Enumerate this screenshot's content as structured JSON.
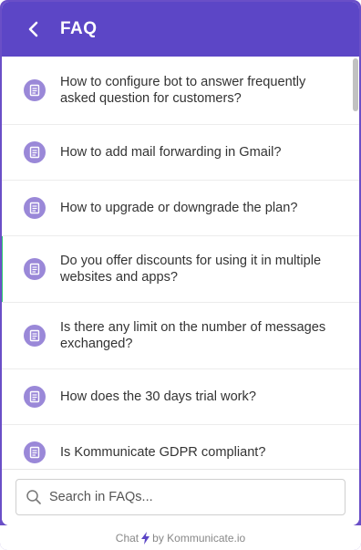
{
  "header": {
    "title": "FAQ",
    "accent_color": "#5c46c6"
  },
  "faqs": [
    {
      "question": "How to configure bot to answer frequently asked question for customers?",
      "icon": "document-icon"
    },
    {
      "question": "How to add mail forwarding in Gmail?",
      "icon": "document-icon"
    },
    {
      "question": "How to upgrade or downgrade the plan?",
      "icon": "document-icon"
    },
    {
      "question": "Do you offer discounts for using it in multiple websites and apps?",
      "icon": "document-icon"
    },
    {
      "question": "Is there any limit on the number of messages exchanged?",
      "icon": "document-icon"
    },
    {
      "question": "How does the 30 days trial work?",
      "icon": "document-icon"
    },
    {
      "question": "Is Kommunicate GDPR compliant?",
      "icon": "document-icon"
    }
  ],
  "search": {
    "placeholder": "Search in FAQs..."
  },
  "footer": {
    "chat_label": "Chat",
    "by_label": "by Kommunicate.io",
    "bolt_color": "#5c46c6"
  }
}
